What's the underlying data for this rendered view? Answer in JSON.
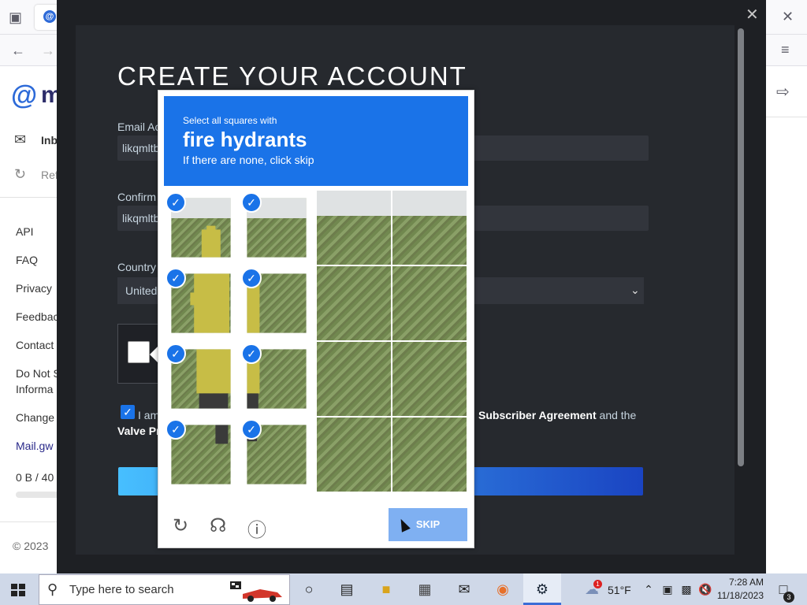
{
  "browser": {
    "tab_favicon": "@",
    "menu_icon": "hamburger-icon"
  },
  "mail_panel": {
    "logo_at": "@",
    "logo_partial": "m",
    "nav_inbox": "Inb",
    "nav_refresh": "Ref",
    "links": [
      "API",
      "FAQ",
      "Privacy",
      "Feedbac",
      "Contact",
      "Do Not S",
      "Informa",
      "Change",
      "Mail.gw"
    ],
    "storage_text": "0 B  / 40",
    "copyright": "© 2023"
  },
  "steam_form": {
    "title": "CREATE YOUR ACCOUNT",
    "email_label": "Email Ac",
    "email_value": "likqmltb",
    "confirm_label": "Confirm",
    "confirm_value": "likqmltb",
    "country_label": "Country",
    "country_value": "United",
    "agree_prefix": "I am",
    "agree_link1": "Subscriber Agreement",
    "agree_mid": " and the",
    "agree_link2": "Valve Pr"
  },
  "captcha": {
    "instruction": "Select all squares with",
    "target": "fire hydrants",
    "hint": "If there are none, click skip",
    "skip_label": "SKIP",
    "selected_tiles": [
      0,
      1,
      4,
      5,
      8,
      9,
      12,
      13
    ],
    "accent": "#1a73e8"
  },
  "taskbar": {
    "search_placeholder": "Type here to search",
    "weather_temp": "51°F",
    "weather_badge": "1",
    "time": "7:28 AM",
    "date": "11/18/2023",
    "notification_count": "3"
  }
}
